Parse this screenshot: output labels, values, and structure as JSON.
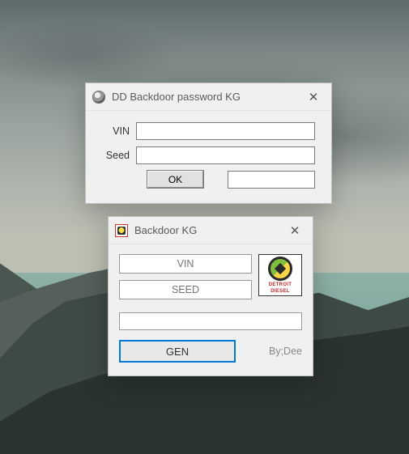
{
  "window1": {
    "title": "DD Backdoor password KG",
    "vin_label": "VIN",
    "seed_label": "Seed",
    "vin_value": "",
    "seed_value": "",
    "ok_label": "OK",
    "output_value": ""
  },
  "window2": {
    "title": "Backdoor KG",
    "vin_placeholder": "VIN",
    "seed_placeholder": "SEED",
    "vin_value": "",
    "seed_value": "",
    "output_value": "",
    "gen_label": "GEN",
    "credit": "By;Dee",
    "logo": {
      "line1": "DETROIT",
      "line2": "DIESEL"
    }
  }
}
